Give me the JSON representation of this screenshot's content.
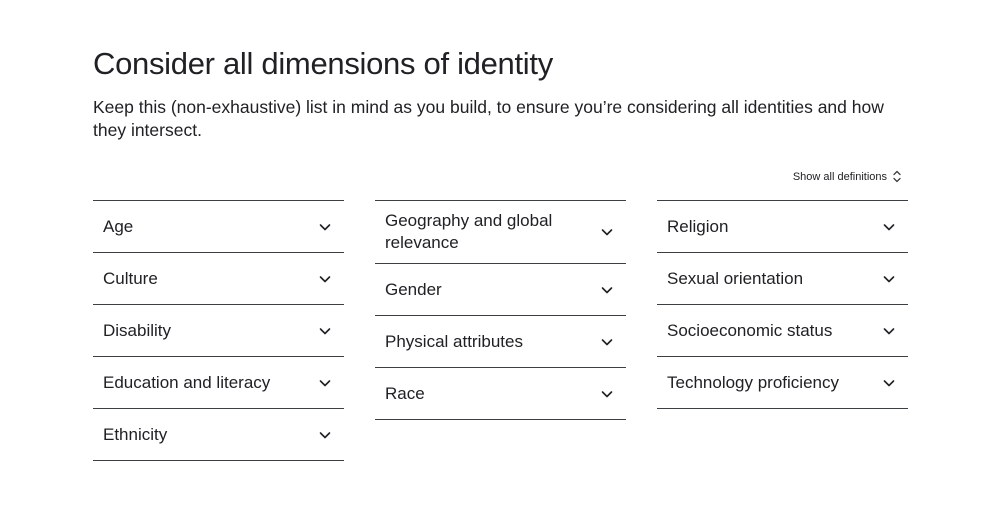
{
  "header": {
    "title": "Consider all dimensions of identity",
    "subtitle": "Keep this (non-exhaustive) list in mind as you build, to ensure you’re considering all identities and how they intersect."
  },
  "controls": {
    "show_all_label": "Show all definitions"
  },
  "columns": [
    {
      "items": [
        {
          "label": "Age"
        },
        {
          "label": "Culture"
        },
        {
          "label": "Disability"
        },
        {
          "label": "Education and literacy"
        },
        {
          "label": "Ethnicity"
        }
      ]
    },
    {
      "items": [
        {
          "label": "Geography and global relevance"
        },
        {
          "label": "Gender"
        },
        {
          "label": "Physical attributes"
        },
        {
          "label": "Race"
        }
      ]
    },
    {
      "items": [
        {
          "label": "Religion"
        },
        {
          "label": "Sexual orientation"
        },
        {
          "label": "Socioeconomic status"
        },
        {
          "label": "Technology proficiency"
        }
      ]
    }
  ],
  "icons": {
    "item_expand": "chevron-down-icon",
    "show_all": "unfold-more-icon"
  }
}
